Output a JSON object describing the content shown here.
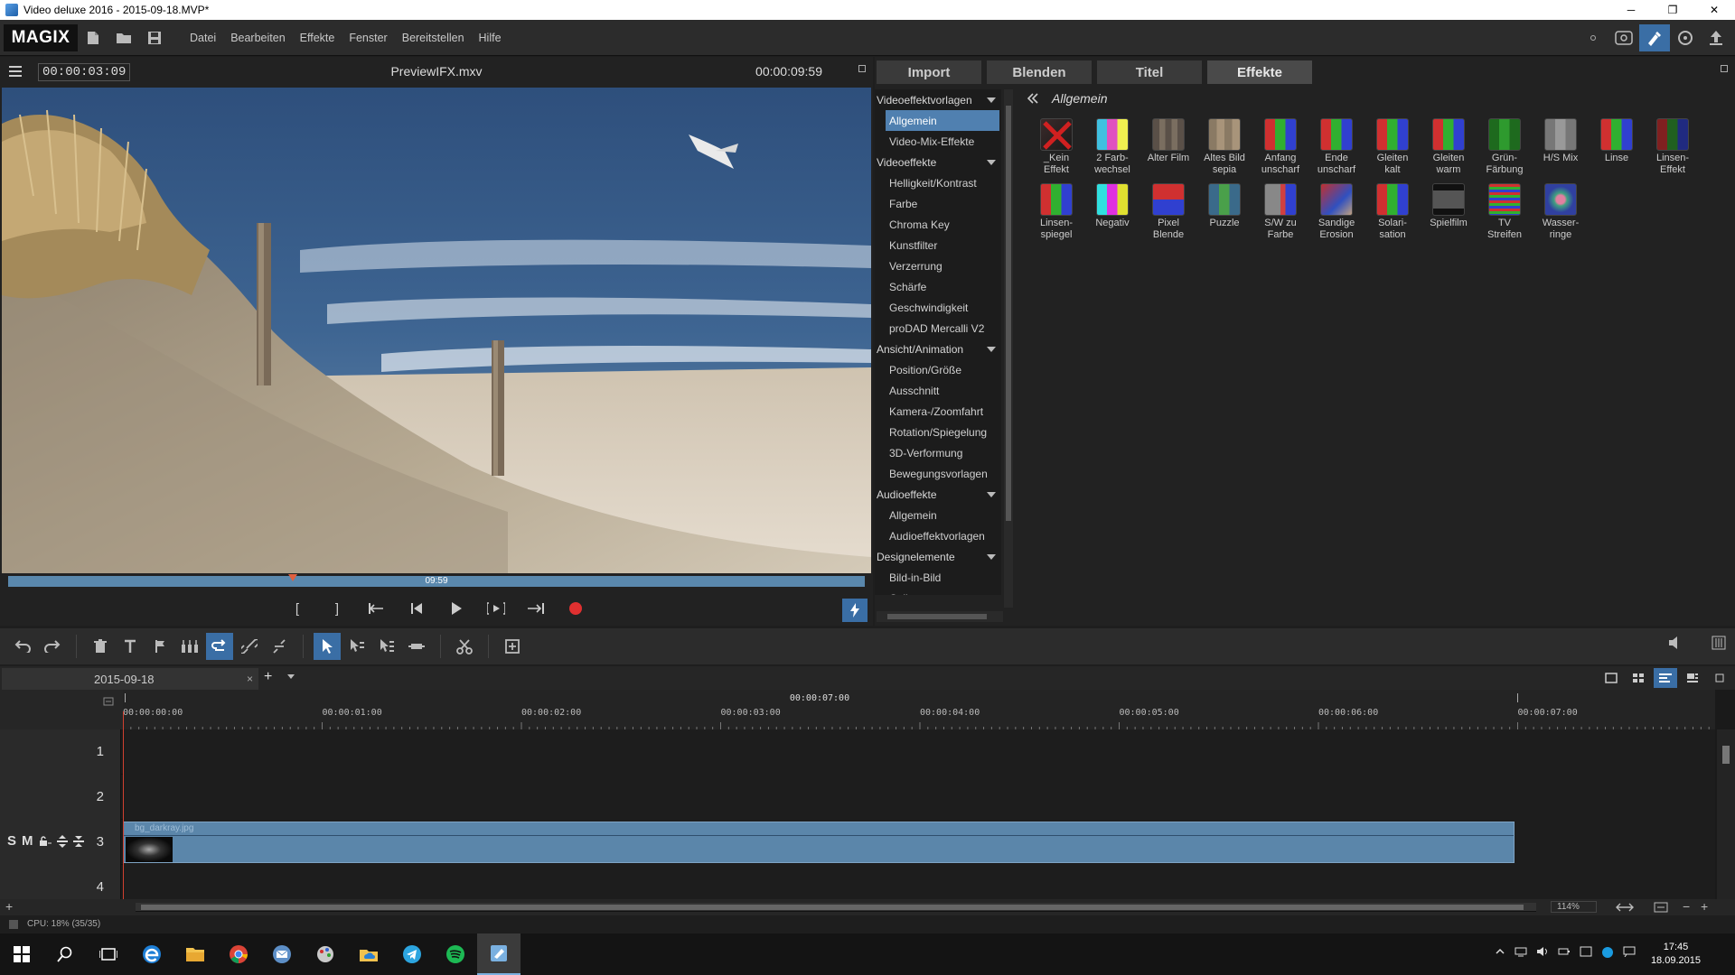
{
  "window": {
    "title": "Video deluxe 2016 - 2015-09-18.MVP*",
    "minimize": "─",
    "restore": "❐",
    "close": "✕"
  },
  "menubar": {
    "logo": "MAGIX",
    "items": [
      "Datei",
      "Bearbeiten",
      "Effekte",
      "Fenster",
      "Bereitstellen",
      "Hilfe"
    ]
  },
  "preview": {
    "timecode_left": "00:00:03:09",
    "filename": "PreviewIFX.mxv",
    "timecode_right": "00:00:09:59",
    "scrub_time": "09:59",
    "transport": [
      "[",
      "]",
      "[⇤",
      "⏮",
      "▶",
      "[▸]",
      "⇥"
    ]
  },
  "pool": {
    "tabs": [
      "Import",
      "Blenden",
      "Titel",
      "Effekte"
    ],
    "active_tab": "Effekte",
    "tree": [
      {
        "type": "h",
        "label": "Videoeffektvorlagen"
      },
      {
        "type": "i",
        "label": "Allgemein",
        "selected": true
      },
      {
        "type": "i",
        "label": "Video-Mix-Effekte"
      },
      {
        "type": "h",
        "label": "Videoeffekte"
      },
      {
        "type": "i",
        "label": "Helligkeit/Kontrast"
      },
      {
        "type": "i",
        "label": "Farbe"
      },
      {
        "type": "i",
        "label": "Chroma Key"
      },
      {
        "type": "i",
        "label": "Kunstfilter"
      },
      {
        "type": "i",
        "label": "Verzerrung"
      },
      {
        "type": "i",
        "label": "Schärfe"
      },
      {
        "type": "i",
        "label": "Geschwindigkeit"
      },
      {
        "type": "i",
        "label": "proDAD Mercalli V2"
      },
      {
        "type": "h",
        "label": "Ansicht/Animation"
      },
      {
        "type": "i",
        "label": "Position/Größe"
      },
      {
        "type": "i",
        "label": "Ausschnitt"
      },
      {
        "type": "i",
        "label": "Kamera-/Zoomfahrt"
      },
      {
        "type": "i",
        "label": "Rotation/Spiegelung"
      },
      {
        "type": "i",
        "label": "3D-Verformung"
      },
      {
        "type": "i",
        "label": "Bewegungsvorlagen"
      },
      {
        "type": "h",
        "label": "Audioeffekte"
      },
      {
        "type": "i",
        "label": "Allgemein"
      },
      {
        "type": "i",
        "label": "Audioeffektvorlagen"
      },
      {
        "type": "h",
        "label": "Designelemente"
      },
      {
        "type": "i",
        "label": "Bild-in-Bild"
      },
      {
        "type": "i",
        "label": "Collagen"
      }
    ],
    "breadcrumb": "Allgemein",
    "effects": [
      {
        "label": "_Kein\nEffekt",
        "style": "none"
      },
      {
        "label": "2 Farb-\nwechsel",
        "style": "bars2"
      },
      {
        "label": "Alter Film",
        "style": "old"
      },
      {
        "label": "Altes Bild\nsepia",
        "style": "sepia"
      },
      {
        "label": "Anfang\nunscharf",
        "style": "rgb"
      },
      {
        "label": "Ende\nunscharf",
        "style": "rgb"
      },
      {
        "label": "Gleiten\nkalt",
        "style": "rgb"
      },
      {
        "label": "Gleiten\nwarm",
        "style": "rgb"
      },
      {
        "label": "Grün-\nFärbung",
        "style": "green"
      },
      {
        "label": "H/S Mix",
        "style": "gray"
      },
      {
        "label": "Linse",
        "style": "rgb"
      },
      {
        "label": "Linsen-\nEffekt",
        "style": "rgbdark"
      },
      {
        "label": "Linsen-\nspiegel",
        "style": "rgb"
      },
      {
        "label": "Negativ",
        "style": "neg"
      },
      {
        "label": "Pixel\nBlende",
        "style": "pixel"
      },
      {
        "label": "Puzzle",
        "style": "puzzle"
      },
      {
        "label": "S/W zu\nFarbe",
        "style": "bw"
      },
      {
        "label": "Sandige\nErosion",
        "style": "sand"
      },
      {
        "label": "Solari-\nsation",
        "style": "rgb"
      },
      {
        "label": "Spielfilm",
        "style": "film"
      },
      {
        "label": "TV\nStreifen",
        "style": "tv"
      },
      {
        "label": "Wasser-\nringe",
        "style": "water"
      }
    ]
  },
  "project": {
    "tab_name": "2015-09-18",
    "close": "×",
    "add": "+"
  },
  "timeline": {
    "range_label": "00:00:07:00",
    "ticks": [
      "00:00:00:00",
      "00:00:01:00",
      "00:00:02:00",
      "00:00:03:00",
      "00:00:04:00",
      "00:00:05:00",
      "00:00:06:00",
      "00:00:07:00"
    ],
    "tracks": [
      "1",
      "2",
      "3",
      "4"
    ],
    "track3_ctrls": [
      "S",
      "M"
    ],
    "clip_name": "bg_darkray.jpg",
    "zoom": "114%"
  },
  "status": {
    "cpu": "CPU: 18% (35/35)"
  },
  "taskbar": {
    "time": "17:45",
    "date": "18.09.2015"
  },
  "colors": {
    "accent": "#3a6ea5",
    "clip": "#5b86aa",
    "playhead": "#d04030",
    "record": "#e03030"
  }
}
